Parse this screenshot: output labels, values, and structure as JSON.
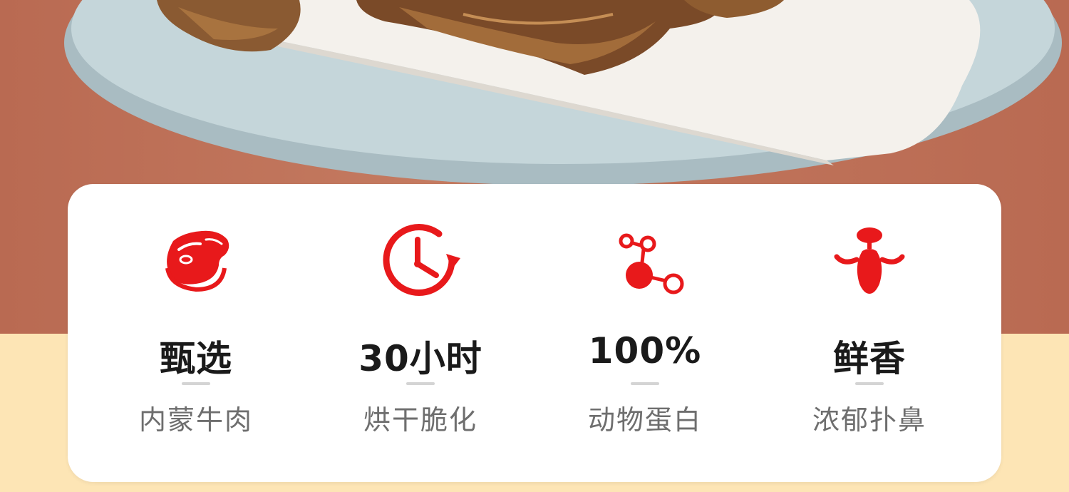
{
  "features": [
    {
      "title": "甄选",
      "subtitle": "内蒙牛肉",
      "icon": "beef-steak-icon"
    },
    {
      "title": "30小时",
      "subtitle": "烘干脆化",
      "icon": "clock-rotate-icon"
    },
    {
      "title": "100%",
      "subtitle": "动物蛋白",
      "icon": "molecule-icon"
    },
    {
      "title": "鲜香",
      "subtitle": "浓郁扑鼻",
      "icon": "nose-aroma-icon"
    }
  ],
  "colors": {
    "accent": "#e8191b",
    "top_background": "#b96a52",
    "bottom_background": "#fde5b5",
    "card": "#ffffff"
  }
}
